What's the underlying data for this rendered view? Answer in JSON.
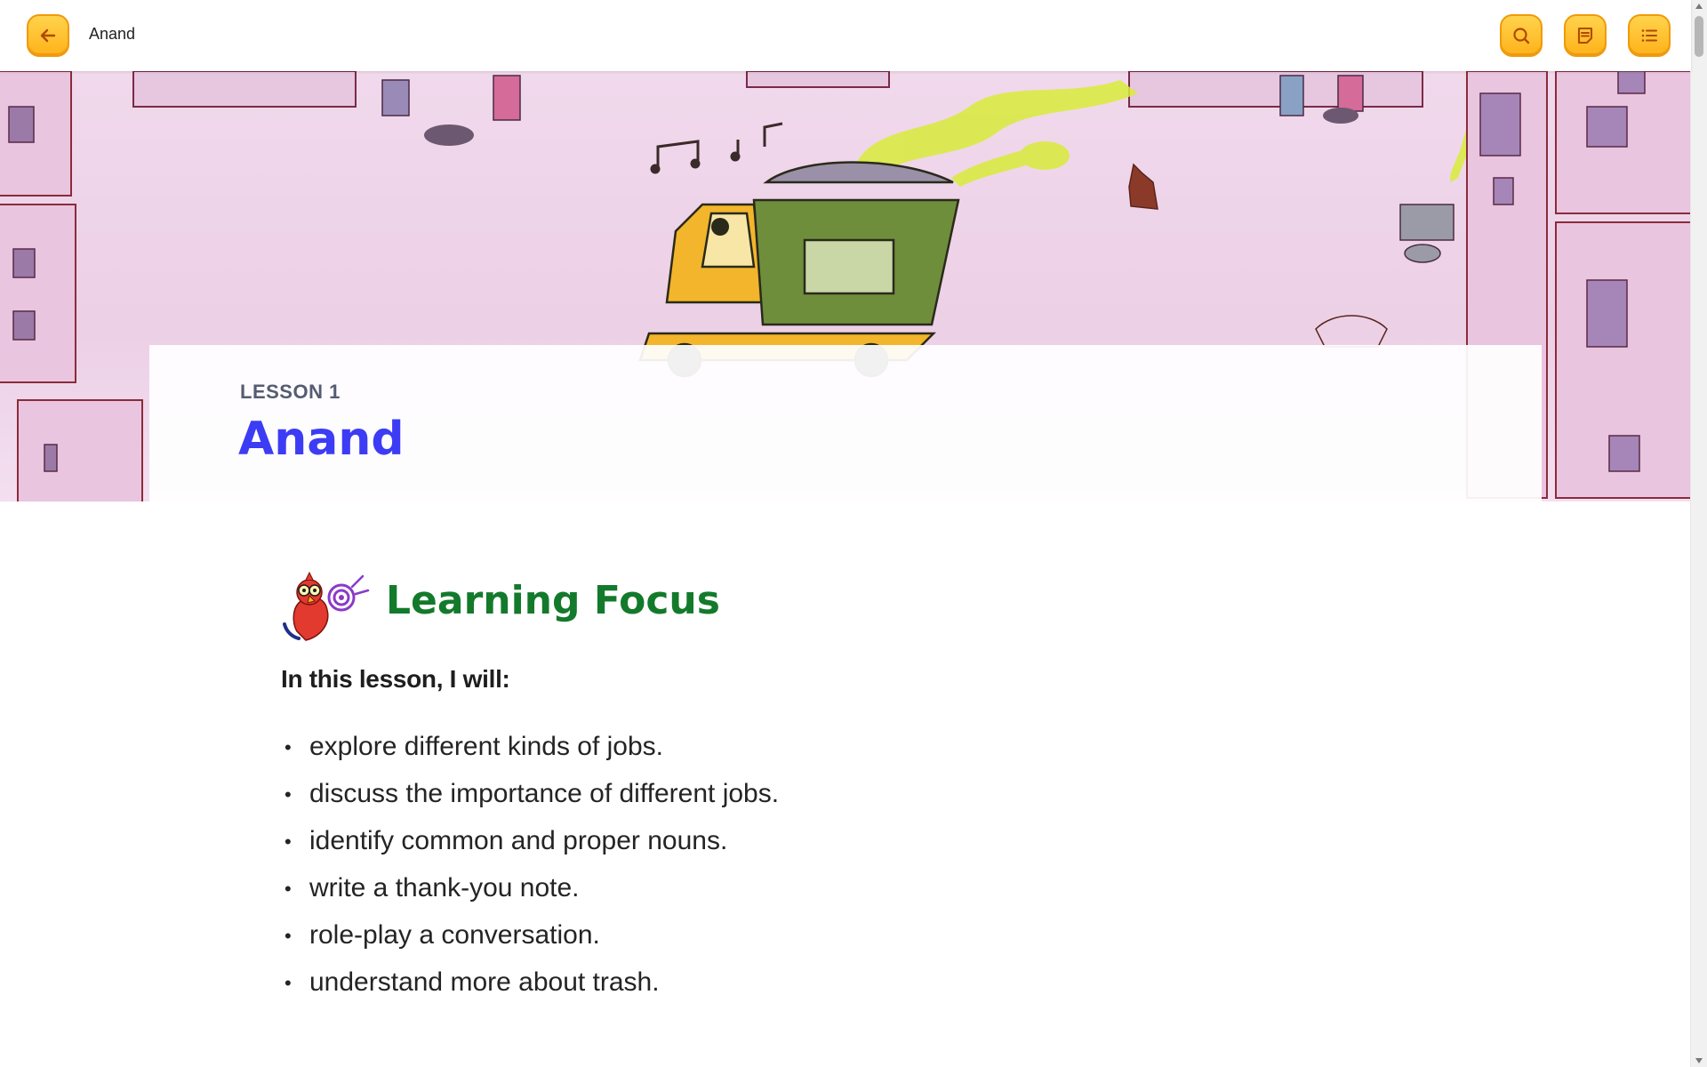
{
  "header": {
    "title": "Anand",
    "back_icon": "arrow-left-icon",
    "actions": [
      "search-icon",
      "notes-icon",
      "list-icon"
    ]
  },
  "lesson": {
    "label": "LESSON 1",
    "title": "Anand"
  },
  "learning_focus": {
    "heading": "Learning Focus",
    "intro": "In this lesson, I will:",
    "items": [
      "explore different kinds of jobs.",
      "discuss the importance of different jobs.",
      "identify common and proper nouns.",
      "write a thank-you note.",
      "role-play a conversation.",
      "understand more about trash."
    ]
  },
  "colors": {
    "accent_button": "#ffb21a",
    "lesson_title": "#3d3cf5",
    "focus_heading": "#137a2b",
    "hero_background": "#f1d9ec"
  }
}
